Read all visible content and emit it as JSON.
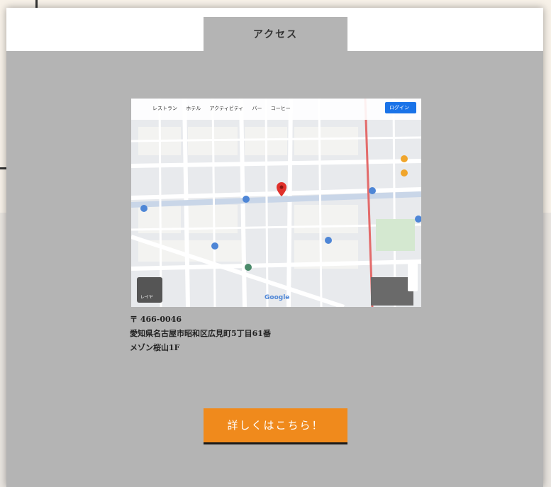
{
  "tabs": {
    "access_label": "アクセス"
  },
  "map": {
    "filter_chips": [
      "レストラン",
      "ホテル",
      "アクティビティ",
      "バー",
      "コーヒー"
    ],
    "login_label": "ログイン",
    "layer_label": "レイヤ",
    "google_label": "Google",
    "pin_color": "#e0312c",
    "route_color": "#e36b6b"
  },
  "address": {
    "postal": "〒 466-0046",
    "line1": "愛知県名古屋市昭和区広見町5丁目61番",
    "line2": "メゾン桜山1F"
  },
  "cta": {
    "label": "詳しくはこちら！",
    "color": "#f08a1c"
  }
}
